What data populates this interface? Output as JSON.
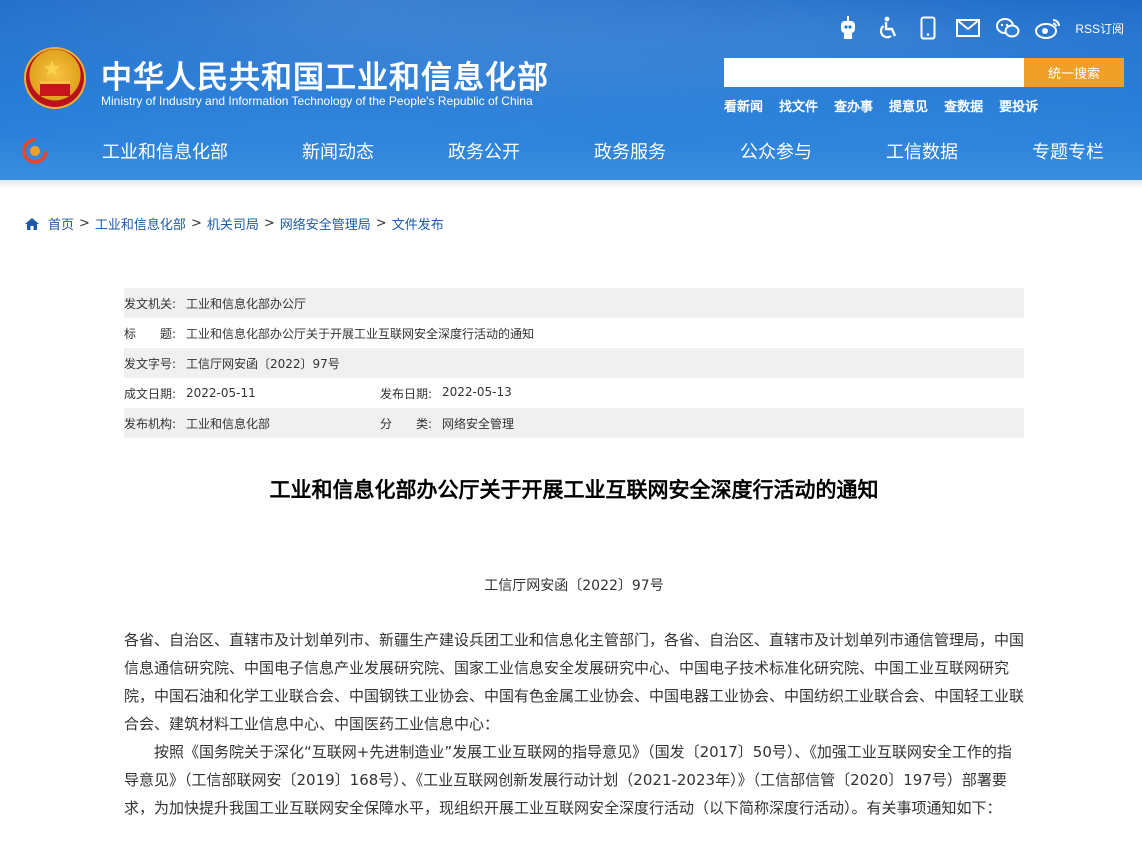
{
  "header": {
    "site_title": "中华人民共和国工业和信息化部",
    "site_subtitle": "Ministry of Industry and Information Technology of the People's Republic of China",
    "rss_label": "RSS订阅",
    "search": {
      "placeholder": "",
      "button_label": "统一搜索"
    },
    "quick_links": [
      "看新闻",
      "找文件",
      "查办事",
      "提意见",
      "查数据",
      "要投诉"
    ],
    "nav": [
      "工业和信息化部",
      "新闻动态",
      "政务公开",
      "政务服务",
      "公众参与",
      "工信数据",
      "专题专栏"
    ]
  },
  "breadcrumb": [
    "首页",
    "工业和信息化部",
    "机关司局",
    "网络安全管理局",
    "文件发布"
  ],
  "meta": {
    "issuer_label": "发文机关:",
    "issuer": "工业和信息化部办公厅",
    "title_label": "标　　题:",
    "title": "工业和信息化部办公厅关于开展工业互联网安全深度行活动的通知",
    "docno_label": "发文字号:",
    "docno": "工信厅网安函〔2022〕97号",
    "created_label": "成文日期:",
    "created": "2022-05-11",
    "published_label": "发布日期:",
    "published": "2022-05-13",
    "org_label": "发布机构:",
    "org": "工业和信息化部",
    "category_label": "分　　类:",
    "category": "网络安全管理"
  },
  "article": {
    "title": "工业和信息化部办公厅关于开展工业互联网安全深度行活动的通知",
    "doc_number": "工信厅网安函〔2022〕97号",
    "paragraphs": [
      "各省、自治区、直辖市及计划单列市、新疆生产建设兵团工业和信息化主管部门，各省、自治区、直辖市及计划单列市通信管理局，中国信息通信研究院、中国电子信息产业发展研究院、国家工业信息安全发展研究中心、中国电子技术标准化研究院、中国工业互联网研究院，中国石油和化学工业联合会、中国钢铁工业协会、中国有色金属工业协会、中国电器工业协会、中国纺织工业联合会、中国轻工业联合会、建筑材料工业信息中心、中国医药工业信息中心：",
      "按照《国务院关于深化“互联网+先进制造业”发展工业互联网的指导意见》（国发〔2017〕50号）、《加强工业互联网安全工作的指导意见》（工信部联网安〔2019〕168号）、《工业互联网创新发展行动计划（2021-2023年）》（工信部信管〔2020〕197号）部署要求，为加快提升我国工业互联网安全保障水平，现组织开展工业互联网安全深度行活动（以下简称深度行活动）。有关事项通知如下："
    ]
  }
}
